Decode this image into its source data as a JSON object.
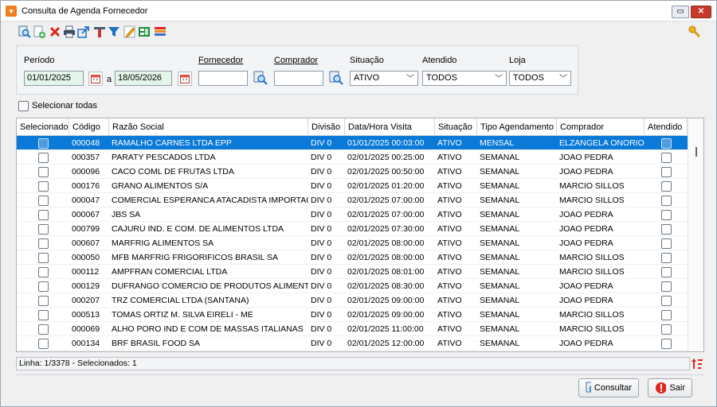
{
  "window": {
    "title": "Consulta de Agenda Fornecedor",
    "restore_glyph": "▭",
    "close_glyph": "✕"
  },
  "toolbar": {
    "icons": [
      "search-icon",
      "new-document-icon",
      "delete-icon",
      "print-icon",
      "export-icon",
      "tools-icon",
      "filter-icon",
      "edit-icon",
      "spreadsheet-icon",
      "report-icon"
    ],
    "right_icon": "key-icon"
  },
  "filters": {
    "periodo_label": "Período",
    "date_from": "01/01/2025",
    "date_sep": "a",
    "date_to": "18/05/2026",
    "fornecedor_label": "Fornecedor",
    "fornecedor_value": "",
    "comprador_label": "Comprador",
    "comprador_value": "",
    "situacao_label": "Situação",
    "situacao_value": "ATIVO",
    "atendido_label": "Atendido",
    "atendido_value": "TODOS",
    "loja_label": "Loja",
    "loja_value": "TODOS"
  },
  "select_all_label": "Selecionar todas",
  "grid": {
    "columns": [
      "Selecionado",
      "Código",
      "Razão Social",
      "Divisão",
      "Data/Hora Visita",
      "Situação",
      "Tipo Agendamento",
      "Comprador",
      "Atendido"
    ],
    "rows": [
      {
        "codigo": "000048",
        "razao": "RAMALHO CARNES LTDA EPP",
        "divisao": "DIV 0",
        "data": "01/01/2025 00:03:00",
        "situacao": "ATIVO",
        "tipo": "MENSAL",
        "comprador": "ELZANGELA ONORIO",
        "selected": true
      },
      {
        "codigo": "000357",
        "razao": "PARATY PESCADOS LTDA",
        "divisao": "DIV 0",
        "data": "02/01/2025 00:25:00",
        "situacao": "ATIVO",
        "tipo": "SEMANAL",
        "comprador": "JOAO PEDRA",
        "selected": false
      },
      {
        "codigo": "000096",
        "razao": "CACO COML DE FRUTAS LTDA",
        "divisao": "DIV 0",
        "data": "02/01/2025 00:50:00",
        "situacao": "ATIVO",
        "tipo": "SEMANAL",
        "comprador": "JOAO PEDRA",
        "selected": false
      },
      {
        "codigo": "000176",
        "razao": "GRANO ALIMENTOS S/A",
        "divisao": "DIV 0",
        "data": "02/01/2025 01:20:00",
        "situacao": "ATIVO",
        "tipo": "SEMANAL",
        "comprador": "MARCIO SILLOS",
        "selected": false
      },
      {
        "codigo": "000047",
        "razao": "COMERCIAL ESPERANCA ATACADISTA IMPORTACA",
        "divisao": "DIV 0",
        "data": "02/01/2025 07:00:00",
        "situacao": "ATIVO",
        "tipo": "SEMANAL",
        "comprador": "MARCIO SILLOS",
        "selected": false
      },
      {
        "codigo": "000067",
        "razao": "JBS SA",
        "divisao": "DIV 0",
        "data": "02/01/2025 07:00:00",
        "situacao": "ATIVO",
        "tipo": "SEMANAL",
        "comprador": "JOAO PEDRA",
        "selected": false
      },
      {
        "codigo": "000799",
        "razao": "CAJURU IND. E COM. DE ALIMENTOS LTDA",
        "divisao": "DIV 0",
        "data": "02/01/2025 07:30:00",
        "situacao": "ATIVO",
        "tipo": "SEMANAL",
        "comprador": "JOAO PEDRA",
        "selected": false
      },
      {
        "codigo": "000607",
        "razao": "MARFRIG ALIMENTOS SA",
        "divisao": "DIV 0",
        "data": "02/01/2025 08:00:00",
        "situacao": "ATIVO",
        "tipo": "SEMANAL",
        "comprador": "JOAO PEDRA",
        "selected": false
      },
      {
        "codigo": "000050",
        "razao": "MFB MARFRIG FRIGORIFICOS BRASIL SA",
        "divisao": "DIV 0",
        "data": "02/01/2025 08:00:00",
        "situacao": "ATIVO",
        "tipo": "SEMANAL",
        "comprador": "MARCIO SILLOS",
        "selected": false
      },
      {
        "codigo": "000112",
        "razao": "AMPFRAN COMERCIAL LTDA",
        "divisao": "DIV 0",
        "data": "02/01/2025 08:01:00",
        "situacao": "ATIVO",
        "tipo": "SEMANAL",
        "comprador": "MARCIO SILLOS",
        "selected": false
      },
      {
        "codigo": "000129",
        "razao": "DUFRANGO COMERCIO DE PRODUTOS ALIMENTICI",
        "divisao": "DIV 0",
        "data": "02/01/2025 08:30:00",
        "situacao": "ATIVO",
        "tipo": "SEMANAL",
        "comprador": "JOAO PEDRA",
        "selected": false
      },
      {
        "codigo": "000207",
        "razao": "TRZ COMERCIAL LTDA (SANTANA)",
        "divisao": "DIV 0",
        "data": "02/01/2025 09:00:00",
        "situacao": "ATIVO",
        "tipo": "SEMANAL",
        "comprador": "JOAO PEDRA",
        "selected": false
      },
      {
        "codigo": "000513",
        "razao": "TOMAS ORTIZ M. SILVA EIRELI - ME",
        "divisao": "DIV 0",
        "data": "02/01/2025 09:00:00",
        "situacao": "ATIVO",
        "tipo": "SEMANAL",
        "comprador": "MARCIO SILLOS",
        "selected": false
      },
      {
        "codigo": "000069",
        "razao": "ALHO PORO IND E COM DE MASSAS ITALIANAS",
        "divisao": "DIV 0",
        "data": "02/01/2025 11:00:00",
        "situacao": "ATIVO",
        "tipo": "SEMANAL",
        "comprador": "MARCIO SILLOS",
        "selected": false
      },
      {
        "codigo": "000134",
        "razao": "BRF BRASIL FOOD SA",
        "divisao": "DIV 0",
        "data": "02/01/2025 12:00:00",
        "situacao": "ATIVO",
        "tipo": "SEMANAL",
        "comprador": "JOAO PEDRA",
        "selected": false
      }
    ]
  },
  "status": {
    "text": "Linha: 1/3378 - Selecionados: 1"
  },
  "buttons": {
    "consultar": "Consultar",
    "sair": "Sair"
  },
  "colors": {
    "selection": "#0a79d8",
    "input_green": "#e4f6e9",
    "close_red": "#c73a2b"
  }
}
